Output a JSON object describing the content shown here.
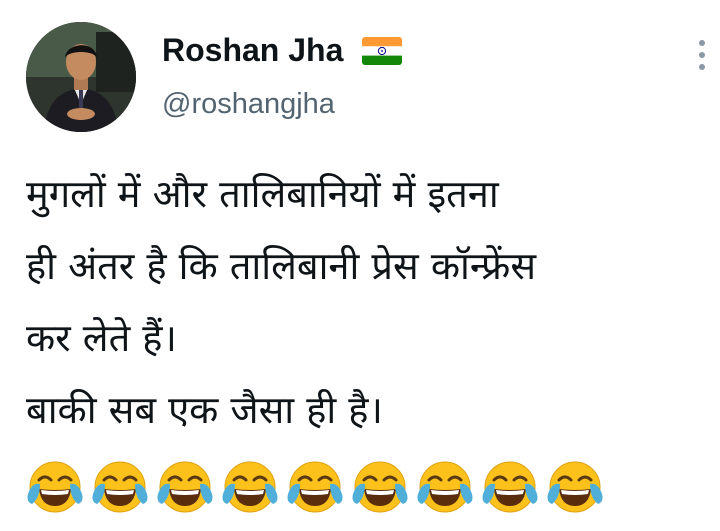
{
  "tweet": {
    "author": {
      "display_name": "Roshan Jha",
      "handle": "@roshangjha",
      "badge_icon": "india-flag-icon",
      "avatar_icon": "profile-photo-avatar"
    },
    "menu_icon": "more-vertical-icon",
    "text_lines": [
      "मुगलों में और तालिबानियों में इतना",
      "ही अंतर है कि तालिबानी प्रेस कॉन्फ्रेंस",
      "कर लेते हैं।",
      "बाकी सब एक जैसा ही है।"
    ],
    "emoji": {
      "icon": "face-with-tears-of-joy-icon",
      "count": 9
    }
  },
  "colors": {
    "text": "#0f1419",
    "secondary_text": "#536471",
    "flag_saffron": "#ff9933",
    "flag_green": "#138808",
    "flag_chakra": "#000080",
    "emoji_face": "#fcc21b",
    "emoji_tears": "#4fafd8"
  }
}
